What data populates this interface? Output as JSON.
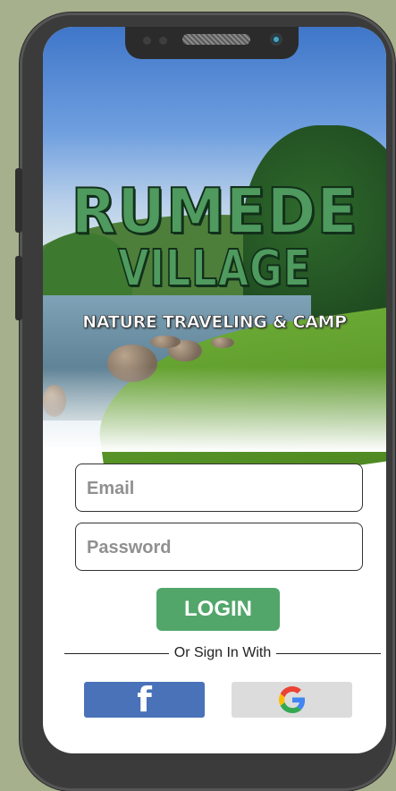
{
  "app": {
    "title_line1": "RUMEDE",
    "title_line2": "VILLAGE",
    "tagline": "NATURE TRAVELING & CAMP"
  },
  "form": {
    "email_placeholder": "Email",
    "password_placeholder": "Password",
    "login_label": "LOGIN",
    "divider_text": "Or Sign In With"
  },
  "social": {
    "facebook_glyph": "f",
    "facebook_icon": "facebook-icon",
    "google_icon": "google-icon"
  },
  "colors": {
    "background": "#a6b08c",
    "brand_green": "#52a66a",
    "facebook_blue": "#4a72b9",
    "google_gray": "#dcdcdc"
  }
}
